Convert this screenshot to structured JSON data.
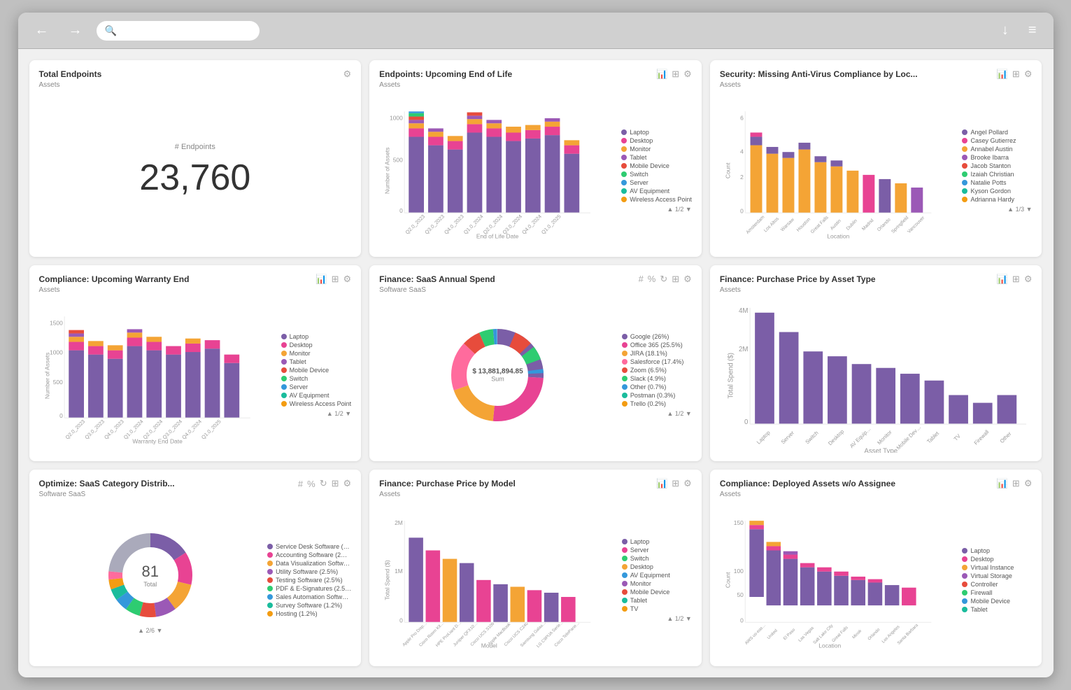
{
  "browser": {
    "back_label": "←",
    "forward_label": "→",
    "download_label": "↓",
    "menu_label": "≡",
    "address_placeholder": ""
  },
  "widgets": {
    "total_endpoints": {
      "title": "Total Endpoints",
      "subtitle": "Assets",
      "y_label": "# Endpoints",
      "value": "23,760"
    },
    "endpoints_eol": {
      "title": "Endpoints: Upcoming End of Life",
      "subtitle": "Assets",
      "legend": [
        {
          "label": "Laptop",
          "color": "#7b5ea7"
        },
        {
          "label": "Desktop",
          "color": "#e84393"
        },
        {
          "label": "Monitor",
          "color": "#f4a435"
        },
        {
          "label": "Tablet",
          "color": "#9b59b6"
        },
        {
          "label": "Mobile Device",
          "color": "#e74c3c"
        },
        {
          "label": "Switch",
          "color": "#2ecc71"
        },
        {
          "label": "Server",
          "color": "#3498db"
        },
        {
          "label": "AV Equipment",
          "color": "#1abc9c"
        },
        {
          "label": "Wireless Access Point",
          "color": "#f39c12"
        }
      ],
      "pagination": "▲ 1/2 ▼",
      "x_label": "End of Life Date",
      "y_label": "Number of Assets"
    },
    "security_antivirus": {
      "title": "Security: Missing Anti-Virus Compliance by Loc...",
      "subtitle": "Assets",
      "legend": [
        {
          "label": "Angel Pollard",
          "color": "#7b5ea7"
        },
        {
          "label": "Casey Gutierrez",
          "color": "#e84393"
        },
        {
          "label": "Annabel Austin",
          "color": "#f4a435"
        },
        {
          "label": "Brooke Ibarra",
          "color": "#9b59b6"
        },
        {
          "label": "Jacob Stanton",
          "color": "#e74c3c"
        },
        {
          "label": "Izaiah Christian",
          "color": "#2ecc71"
        },
        {
          "label": "Natalie Potts",
          "color": "#3498db"
        },
        {
          "label": "Kyson Gordon",
          "color": "#1abc9c"
        },
        {
          "label": "Adrianna Hardy",
          "color": "#f39c12"
        }
      ],
      "pagination": "▲ 1/3 ▼",
      "x_label": "Location",
      "y_label": "Count"
    },
    "compliance_warranty": {
      "title": "Compliance: Upcoming Warranty End",
      "subtitle": "Assets",
      "legend": [
        {
          "label": "Laptop",
          "color": "#7b5ea7"
        },
        {
          "label": "Desktop",
          "color": "#e84393"
        },
        {
          "label": "Monitor",
          "color": "#f4a435"
        },
        {
          "label": "Tablet",
          "color": "#9b59b6"
        },
        {
          "label": "Mobile Device",
          "color": "#e74c3c"
        },
        {
          "label": "Switch",
          "color": "#2ecc71"
        },
        {
          "label": "Server",
          "color": "#3498db"
        },
        {
          "label": "AV Equipment",
          "color": "#1abc9c"
        },
        {
          "label": "Wireless Access Point",
          "color": "#f39c12"
        }
      ],
      "pagination": "▲ 1/2 ▼",
      "x_label": "Warranty End Date",
      "y_label": "Number of Assets"
    },
    "finance_saas": {
      "title": "Finance: SaaS Annual Spend",
      "subtitle": "Software SaaS",
      "center_value": "$ 13,881,894.85",
      "center_label": "Sum",
      "legend": [
        {
          "label": "Google (26%)",
          "color": "#7b5ea7"
        },
        {
          "label": "Office 365 (25.5%)",
          "color": "#e84393"
        },
        {
          "label": "JIRA (18.1%)",
          "color": "#f4a435"
        },
        {
          "label": "Salesforce (17.4%)",
          "color": "#9b59b6"
        },
        {
          "label": "Zoom (6.5%)",
          "color": "#e74c3c"
        },
        {
          "label": "Slack (4.9%)",
          "color": "#2ecc71"
        },
        {
          "label": "Other (0.7%)",
          "color": "#3498db"
        },
        {
          "label": "Postman (0.3%)",
          "color": "#1abc9c"
        },
        {
          "label": "Trello (0.2%)",
          "color": "#f39c12"
        }
      ],
      "pagination": "▲ 1/2 ▼"
    },
    "finance_purchase_asset": {
      "title": "Finance: Purchase Price by Asset Type",
      "subtitle": "Assets",
      "x_label": "Asset Type",
      "y_label": "Total Spend ($)",
      "categories": [
        "Laptop",
        "Server",
        "Switch",
        "Desktop",
        "AV Equipment",
        "Monitor",
        "Mobile Device",
        "Tablet",
        "TV",
        "Firewall",
        "Other"
      ]
    },
    "optimize_saas": {
      "title": "Optimize: SaaS Category Distrib...",
      "subtitle": "Software SaaS",
      "center_value": "81",
      "center_label": "Total",
      "legend": [
        {
          "label": "Service Desk Software (…",
          "color": "#7b5ea7"
        },
        {
          "label": "Accounting Software (2…",
          "color": "#e84393"
        },
        {
          "label": "Data Visualization Softw…",
          "color": "#f4a435"
        },
        {
          "label": "Utility Software (2.5%)",
          "color": "#9b59b6"
        },
        {
          "label": "Testing Software (2.5%)",
          "color": "#e74c3c"
        },
        {
          "label": "PDF & E-Signatures (2.5…",
          "color": "#2ecc71"
        },
        {
          "label": "Sales Automation Softw…",
          "color": "#3498db"
        },
        {
          "label": "Survey Software (1.2%)",
          "color": "#1abc9c"
        },
        {
          "label": "Hosting (1.2%)",
          "color": "#f39c12"
        }
      ],
      "pagination": "▲ 2/6 ▼"
    },
    "finance_purchase_model": {
      "title": "Finance: Purchase Price by Model",
      "subtitle": "Assets",
      "x_label": "Model",
      "y_label": "Total Spend ($)",
      "legend": [
        {
          "label": "Laptop",
          "color": "#7b5ea7"
        },
        {
          "label": "Server",
          "color": "#e84393"
        },
        {
          "label": "Switch",
          "color": "#2ecc71"
        },
        {
          "label": "Desktop",
          "color": "#f4a435"
        },
        {
          "label": "AV Equipment",
          "color": "#3498db"
        },
        {
          "label": "Monitor",
          "color": "#9b59b6"
        },
        {
          "label": "Mobile Device",
          "color": "#e74c3c"
        },
        {
          "label": "Tablet",
          "color": "#1abc9c"
        },
        {
          "label": "TV",
          "color": "#f39c12"
        }
      ],
      "pagination": "▲ 1/2 ▼",
      "models": [
        "Apple Pro Disp…",
        "Cisco Room Kit…",
        "HPE ProLiant D…",
        "Juniper QFX10…",
        "Cisco UCS S108",
        "Apple MacBook",
        "Cisco UCS C240",
        "Samsung Galax…",
        "LG C9PUA Serie…",
        "Cisco TelePane…"
      ]
    },
    "compliance_deployed": {
      "title": "Compliance: Deployed Assets w/o Assignee",
      "subtitle": "Assets",
      "x_label": "Location",
      "y_label": "Count",
      "legend": [
        {
          "label": "Laptop",
          "color": "#7b5ea7"
        },
        {
          "label": "Desktop",
          "color": "#e84393"
        },
        {
          "label": "Virtual Instance",
          "color": "#f4a435"
        },
        {
          "label": "Virtual Storage",
          "color": "#9b59b6"
        },
        {
          "label": "Controller",
          "color": "#e74c3c"
        },
        {
          "label": "Firewall",
          "color": "#2ecc71"
        },
        {
          "label": "Mobile Device",
          "color": "#3498db"
        },
        {
          "label": "Tablet",
          "color": "#1abc9c"
        }
      ],
      "pagination": "",
      "locations": [
        "AWS us-eas…",
        "United",
        "El Paso",
        "Las Vegas",
        "Salt Lake City",
        "Great Falls",
        "Minsk",
        "Orlando",
        "Los Angeles",
        "Santa Barbara"
      ]
    }
  }
}
